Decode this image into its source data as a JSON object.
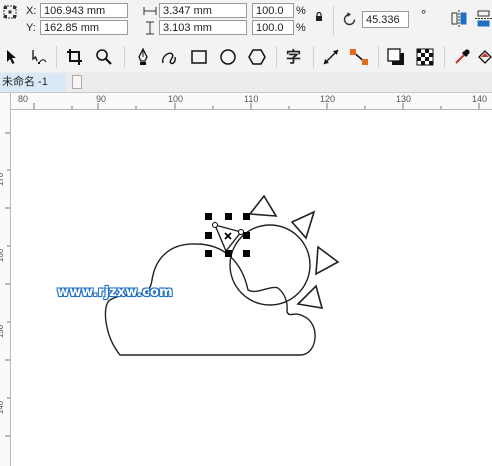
{
  "property_bar": {
    "x_label": "X:",
    "x_value": "106.943 mm",
    "y_label": "Y:",
    "y_value": "162.85 mm",
    "width_value": "3.347 mm",
    "height_value": "3.103 mm",
    "scale_w": "100.0",
    "scale_h": "100.0",
    "percent_sign": "%",
    "rotation_value": "45.336",
    "rotation_unit": "°"
  },
  "toolbar": {
    "text_tool_glyph": "字"
  },
  "document": {
    "tab_label": "未命名 -1"
  },
  "rulers": {
    "horizontal_ticks": [
      "80",
      "90",
      "100",
      "110",
      "120",
      "130",
      "140"
    ],
    "vertical_ticks": [
      "170",
      "160",
      "150",
      "140"
    ]
  },
  "watermark": {
    "text": "www.rjzxw.com"
  },
  "icons": {
    "lock": "lock-icon",
    "rotation": "rotate-icon",
    "pick_tool": "pick-tool-icon",
    "shape_tool": "shape-tool-icon",
    "crop_tool": "crop-tool-icon",
    "zoom_tool": "zoom-tool-icon",
    "pen_tool": "pen-tool-icon",
    "freehand_tool": "freehand-tool-icon",
    "rectangle_tool": "rectangle-tool-icon",
    "ellipse_tool": "ellipse-tool-icon",
    "polygon_tool": "polygon-tool-icon",
    "line_tool": "parallel-dimension-icon",
    "connector_tool": "connector-tool-icon",
    "shadow_tool": "drop-shadow-icon",
    "transparency_tool": "transparency-icon",
    "eyedropper_tool": "eyedropper-icon",
    "fill_tool": "interactive-fill-icon"
  }
}
